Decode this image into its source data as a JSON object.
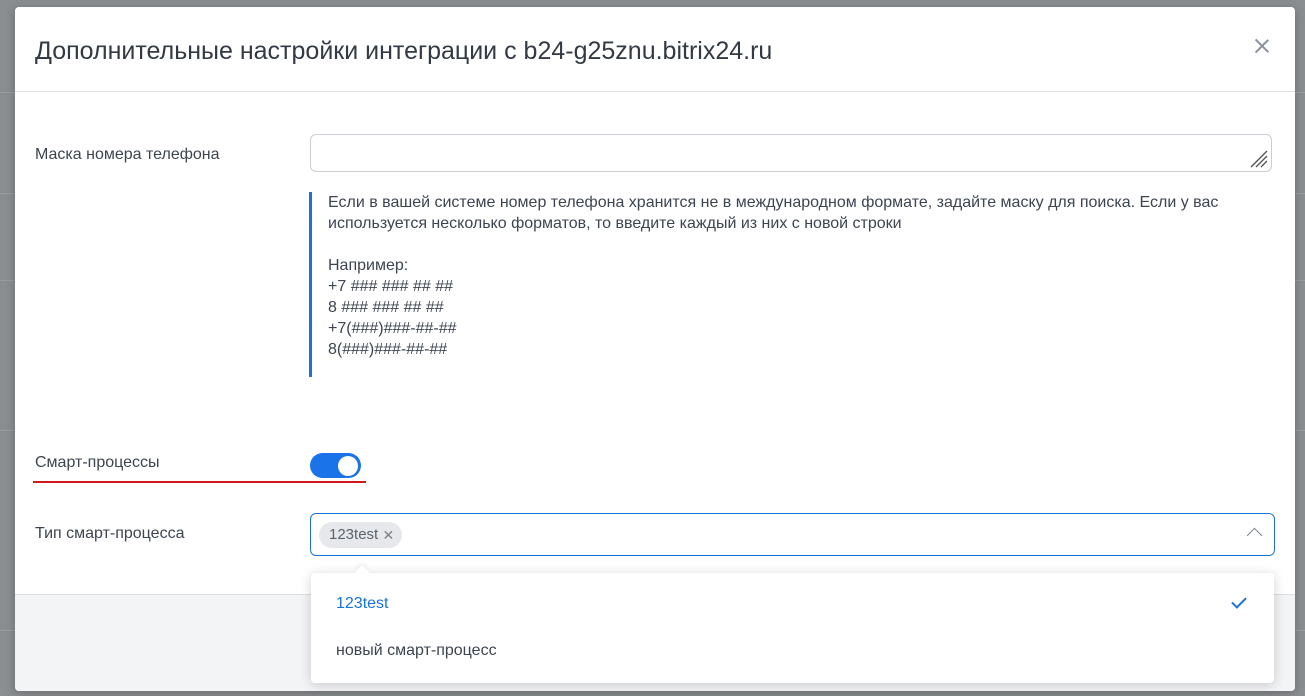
{
  "modal": {
    "title": "Дополнительные настройки интеграции с b24-g25znu.bitrix24.ru"
  },
  "phone_mask": {
    "label": "Маска номера телефона",
    "value": "",
    "hint_text": "Если в вашей системе номер телефона хранится не в международном формате, задайте маску для поиска. Если у вас используется несколько форматов, то введите каждый из них с новой строки",
    "example_title": "Например:",
    "examples": [
      "+7 ### ### ## ##",
      "8 ### ### ## ##",
      "+7(###)###-##-##",
      "8(###)###-##-##"
    ]
  },
  "smart_processes": {
    "label": "Смарт-процессы",
    "enabled": true
  },
  "smart_process_type": {
    "label": "Тип смарт-процесса",
    "selected_chip": "123test",
    "options": [
      {
        "label": "123test",
        "selected": true
      },
      {
        "label": "новый смарт-процесс",
        "selected": false
      }
    ]
  },
  "colors": {
    "accent": "#1a73e8",
    "highlight_underline": "#d0191a"
  }
}
